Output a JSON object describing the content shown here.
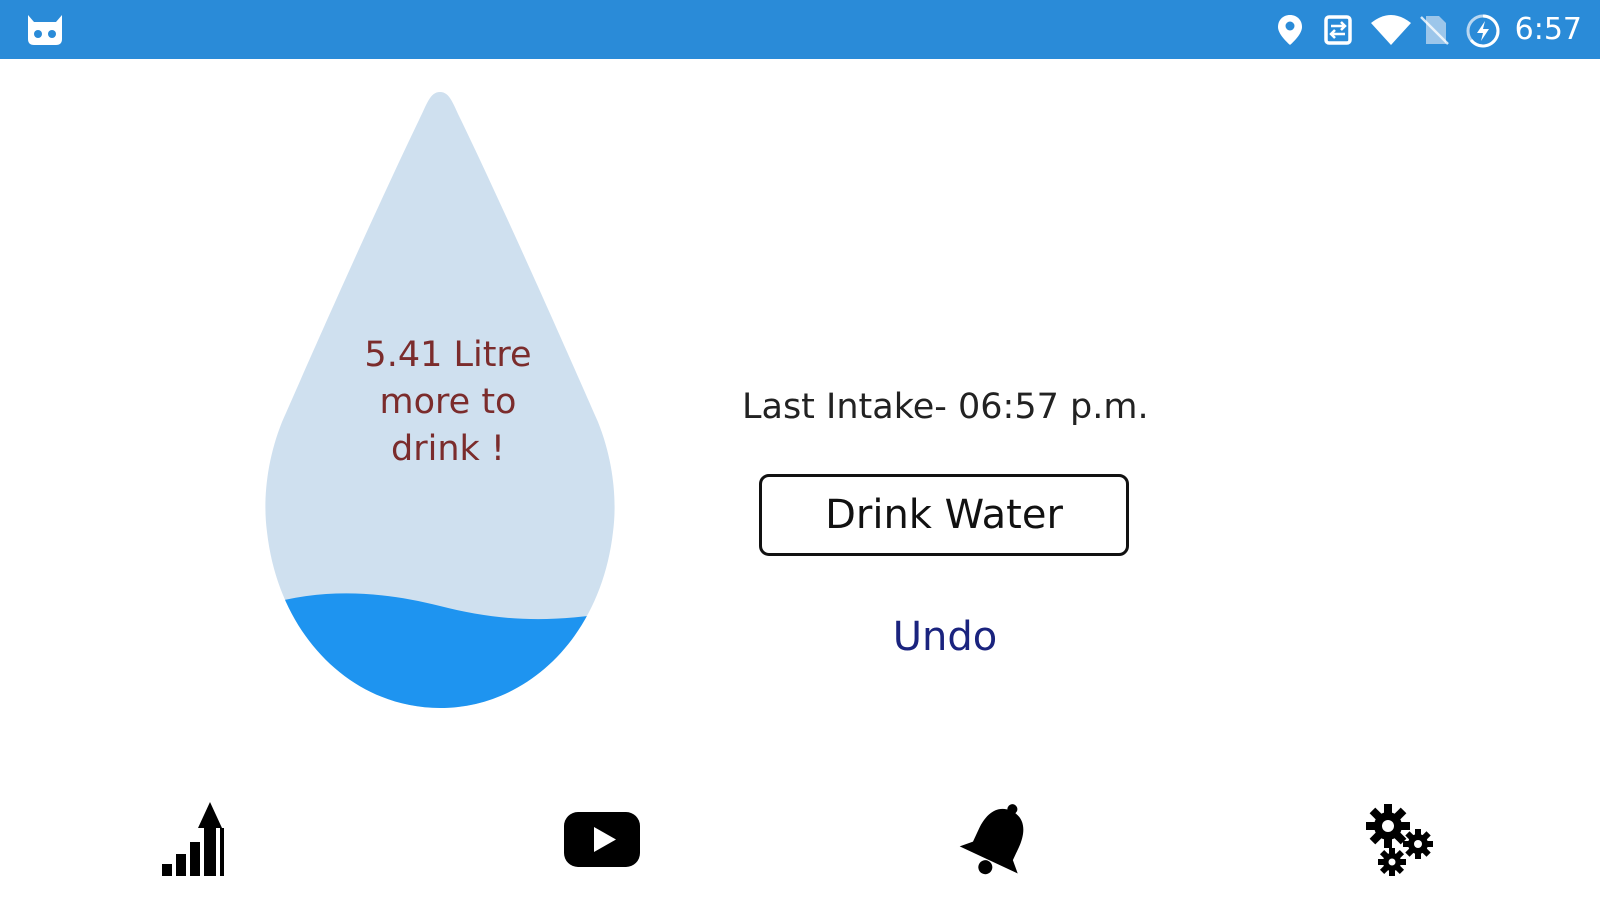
{
  "status_bar": {
    "left_icon": "cyanogen-bot-icon",
    "icons": [
      "location-pin-icon",
      "sim-swap-icon",
      "wifi-icon",
      "no-sim-icon",
      "battery-charging-icon"
    ],
    "time": "6:57",
    "background_color": "#2a8bd8"
  },
  "drop": {
    "line1": "5.41 Litre",
    "line2": "more to",
    "line3": "drink !",
    "light_fill_color": "#cfe0ef",
    "water_fill_color": "#1e94f0",
    "text_color": "#7b2c2c"
  },
  "main": {
    "last_intake": "Last Intake- 06:57 p.m.",
    "drink_button_label": "Drink Water",
    "undo_label": "Undo",
    "undo_color": "#1a237e"
  },
  "bottom_nav": {
    "items": [
      "stats-chart-icon",
      "video-play-icon",
      "reminder-bell-icon",
      "settings-gears-icon"
    ]
  }
}
